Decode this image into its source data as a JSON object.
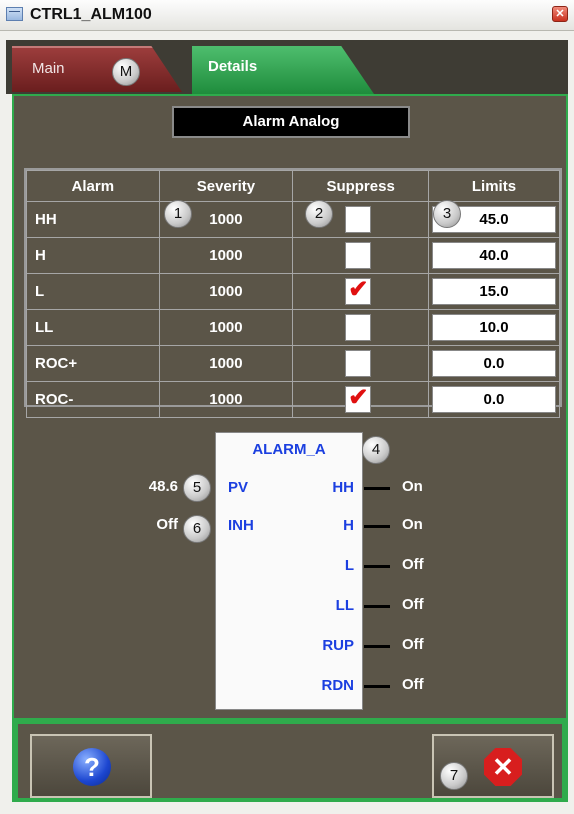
{
  "window": {
    "title": "CTRL1_ALM100",
    "close_glyph": "✕"
  },
  "tabs": {
    "main": "Main",
    "details": "Details",
    "main_badge": "M"
  },
  "section_heading": "Alarm Analog",
  "table": {
    "headers": [
      "Alarm",
      "Severity",
      "Suppress",
      "Limits"
    ],
    "rows": [
      {
        "alarm": "HH",
        "severity": "1000",
        "suppress": false,
        "limit": "45.0"
      },
      {
        "alarm": "H",
        "severity": "1000",
        "suppress": false,
        "limit": "40.0"
      },
      {
        "alarm": "L",
        "severity": "1000",
        "suppress": true,
        "limit": "15.0"
      },
      {
        "alarm": "LL",
        "severity": "1000",
        "suppress": false,
        "limit": "10.0"
      },
      {
        "alarm": "ROC+",
        "severity": "1000",
        "suppress": false,
        "limit": "0.0"
      },
      {
        "alarm": "ROC-",
        "severity": "1000",
        "suppress": true,
        "limit": "0.0"
      }
    ]
  },
  "function_block": {
    "name": "ALARM_A",
    "inputs": [
      {
        "pin": "PV",
        "value": "48.6"
      },
      {
        "pin": "INH",
        "value": "Off"
      }
    ],
    "outputs": [
      {
        "pin": "HH",
        "value": "On"
      },
      {
        "pin": "H",
        "value": "On"
      },
      {
        "pin": "L",
        "value": "Off"
      },
      {
        "pin": "LL",
        "value": "Off"
      },
      {
        "pin": "RUP",
        "value": "Off"
      },
      {
        "pin": "RDN",
        "value": "Off"
      }
    ]
  },
  "callouts": [
    "1",
    "2",
    "3",
    "4",
    "5",
    "6",
    "7"
  ],
  "check_glyph": "✔",
  "buttons": {
    "help_glyph": "?",
    "close_glyph": "✕"
  },
  "icons": {
    "help": "question-icon",
    "close": "stop-x-icon",
    "window": "window-icon"
  },
  "colors": {
    "panel": "#5b5548",
    "accent_green": "#2fab4c",
    "pin_blue": "#1b3fe0",
    "main_tab": "#7a2828",
    "check_red": "#e01010"
  }
}
